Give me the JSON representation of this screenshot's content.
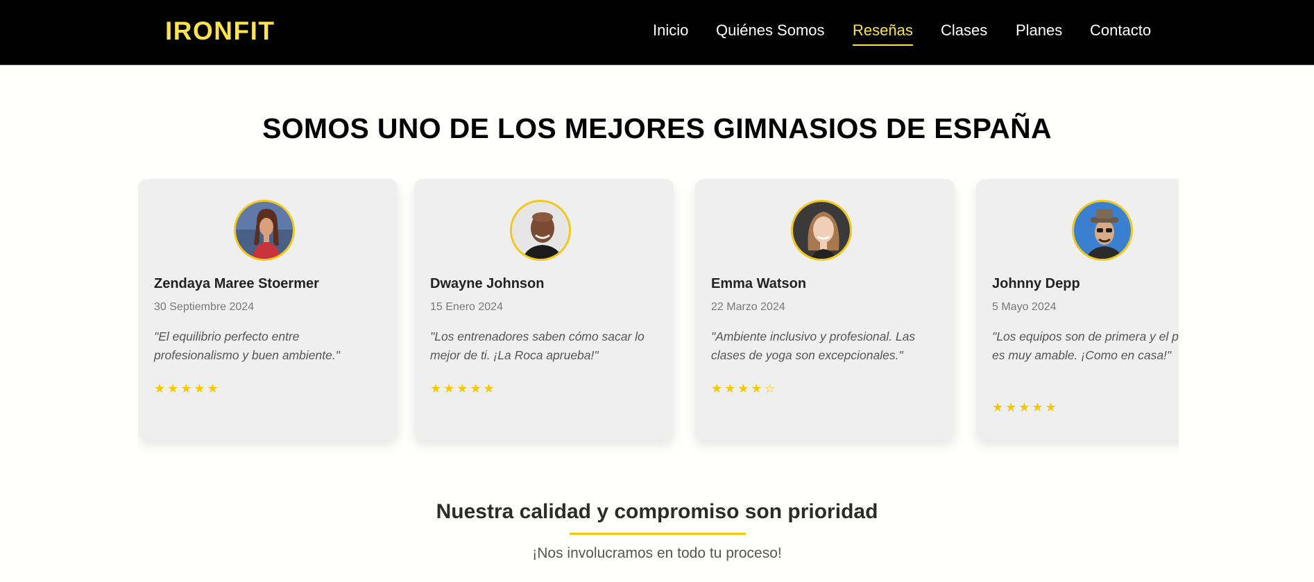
{
  "brand": {
    "logo": "IRONFIT",
    "accent_color": "#fce34a"
  },
  "nav": {
    "items": [
      {
        "label": "Inicio",
        "active": false
      },
      {
        "label": "Quiénes Somos",
        "active": false
      },
      {
        "label": "Reseñas",
        "active": true
      },
      {
        "label": "Clases",
        "active": false
      },
      {
        "label": "Planes",
        "active": false
      },
      {
        "label": "Contacto",
        "active": false
      }
    ]
  },
  "hero": {
    "headline": "SOMOS UNO DE LOS MEJORES GIMNASIOS DE ESPAÑA"
  },
  "reviews": [
    {
      "name": "Zendaya Maree Stoermer",
      "date": "30 Septiembre 2024",
      "quote": "\"El equilibrio perfecto entre profesionalismo y buen ambiente.\"",
      "stars": "★★★★★",
      "rating": 5
    },
    {
      "name": "Dwayne Johnson",
      "date": "15 Enero 2024",
      "quote": "\"Los entrenadores saben cómo sacar lo mejor de ti. ¡La Roca aprueba!\"",
      "stars": "★★★★★",
      "rating": 5
    },
    {
      "name": "Emma Watson",
      "date": "22 Marzo 2024",
      "quote": "\"Ambiente inclusivo y profesional. Las clases de yoga son excepcionales.\"",
      "stars": "★★★★☆",
      "rating": 4
    },
    {
      "name": "Johnny Depp",
      "date": "5 Mayo 2024",
      "quote": "\"Los equipos son de primera y el personal es muy amable. ¡Como en casa!\"",
      "stars": "★★★★★",
      "rating": 5
    }
  ],
  "commitment": {
    "title": "Nuestra calidad y compromiso son prioridad",
    "subtitle": "¡Nos involucramos en todo tu proceso!"
  }
}
